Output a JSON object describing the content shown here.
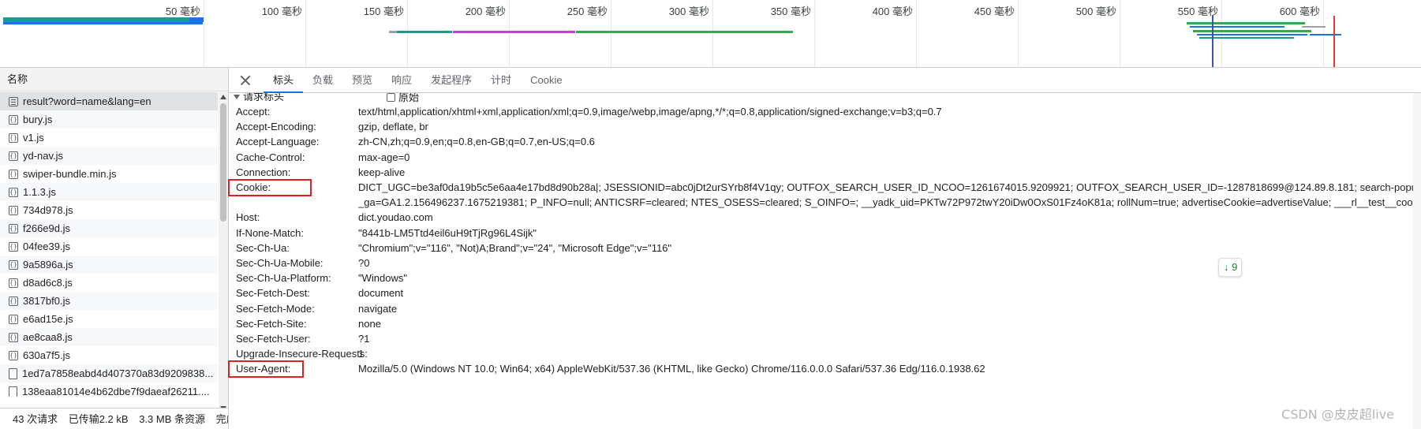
{
  "timeline": {
    "ticks": [
      {
        "label": "50 毫秒"
      },
      {
        "label": "100 毫秒"
      },
      {
        "label": "150 毫秒"
      },
      {
        "label": "200 毫秒"
      },
      {
        "label": "250 毫秒"
      },
      {
        "label": "300 毫秒"
      },
      {
        "label": "350 毫秒"
      },
      {
        "label": "400 毫秒"
      },
      {
        "label": "450 毫秒"
      },
      {
        "label": "500 毫秒"
      },
      {
        "label": "550 毫秒"
      },
      {
        "label": "600 毫秒"
      }
    ],
    "colors": {
      "teal": "#1e9c8a",
      "blue": "#1a73e8",
      "purple": "#c53fd6",
      "green": "#34a853",
      "grey": "#9aa0a6",
      "red_marker": "#e53935",
      "blue_marker": "#3f51b5"
    }
  },
  "request_list": {
    "header": "名称",
    "rows": [
      {
        "name": "result?word=name&lang=en",
        "icon": "document-icon",
        "selected": true
      },
      {
        "name": "bury.js",
        "icon": "script-icon"
      },
      {
        "name": "v1.js",
        "icon": "script-icon"
      },
      {
        "name": "yd-nav.js",
        "icon": "script-icon"
      },
      {
        "name": "swiper-bundle.min.js",
        "icon": "script-icon"
      },
      {
        "name": "1.1.3.js",
        "icon": "script-icon"
      },
      {
        "name": "734d978.js",
        "icon": "script-icon"
      },
      {
        "name": "f266e9d.js",
        "icon": "script-icon"
      },
      {
        "name": "04fee39.js",
        "icon": "script-icon"
      },
      {
        "name": "9a5896a.js",
        "icon": "script-icon"
      },
      {
        "name": "d8ad6c8.js",
        "icon": "script-icon"
      },
      {
        "name": "3817bf0.js",
        "icon": "script-icon"
      },
      {
        "name": "e6ad15e.js",
        "icon": "script-icon"
      },
      {
        "name": "ae8caa8.js",
        "icon": "script-icon"
      },
      {
        "name": "630a7f5.js",
        "icon": "script-icon"
      },
      {
        "name": "1ed7a7858eabd4d407370a83d9209838...",
        "icon": "file-icon"
      },
      {
        "name": "138eaa81014e4b62dbe7f9daeaf26211....",
        "icon": "file-icon"
      }
    ],
    "status": {
      "requests": "43 次请求",
      "transferred": "已传输2.2 kB",
      "resources": "3.3 MB 条资源",
      "finish": "完成:"
    }
  },
  "details": {
    "tabs": [
      {
        "label": "标头",
        "active": true
      },
      {
        "label": "负载"
      },
      {
        "label": "预览"
      },
      {
        "label": "响应"
      },
      {
        "label": "发起程序"
      },
      {
        "label": "计时"
      },
      {
        "label": "Cookie"
      }
    ],
    "section_title": "请求标头",
    "raw_label": "原始",
    "headers": [
      {
        "name": "Accept:",
        "value": "text/html,application/xhtml+xml,application/xml;q=0.9,image/webp,image/apng,*/*;q=0.8,application/signed-exchange;v=b3;q=0.7"
      },
      {
        "name": "Accept-Encoding:",
        "value": "gzip, deflate, br"
      },
      {
        "name": "Accept-Language:",
        "value": "zh-CN,zh;q=0.9,en;q=0.8,en-GB;q=0.7,en-US;q=0.6"
      },
      {
        "name": "Cache-Control:",
        "value": "max-age=0"
      },
      {
        "name": "Connection:",
        "value": "keep-alive"
      },
      {
        "name": "Cookie:",
        "value": "DICT_UGC=be3af0da19b5c5e6aa4e17bd8d90b28a|; JSESSIONID=abc0jDt2urSYrb8f4V1qy; OUTFOX_SEARCH_USER_ID_NCOO=1261674015.9209921; OUTFOX_SEARCH_USER_ID=-1287818699@124.89.8.181; search-popup-show",
        "value2": "_ga=GA1.2.156496237.1675219381; P_INFO=null; ANTICSRF=cleared; NTES_OSESS=cleared; S_OINFO=; __yadk_uid=PKTw72P972twY20iDw0OxS01Fz4oK81a; rollNum=true; advertiseCookie=advertiseValue; ___rl__test__cookies=",
        "highlight": true
      },
      {
        "name": "Host:",
        "value": "dict.youdao.com"
      },
      {
        "name": "If-None-Match:",
        "value": "\"8441b-LM5Ttd4eil6uH9tTjRg96L4Sijk\""
      },
      {
        "name": "Sec-Ch-Ua:",
        "value": "\"Chromium\";v=\"116\", \"Not)A;Brand\";v=\"24\", \"Microsoft Edge\";v=\"116\""
      },
      {
        "name": "Sec-Ch-Ua-Mobile:",
        "value": "?0"
      },
      {
        "name": "Sec-Ch-Ua-Platform:",
        "value": "\"Windows\""
      },
      {
        "name": "Sec-Fetch-Dest:",
        "value": "document"
      },
      {
        "name": "Sec-Fetch-Mode:",
        "value": "navigate"
      },
      {
        "name": "Sec-Fetch-Site:",
        "value": "none"
      },
      {
        "name": "Sec-Fetch-User:",
        "value": "?1"
      },
      {
        "name": "Upgrade-Insecure-Requests:",
        "value": "1"
      },
      {
        "name": "User-Agent:",
        "value": "Mozilla/5.0 (Windows NT 10.0; Win64; x64) AppleWebKit/537.36 (KHTML, like Gecko) Chrome/116.0.0.0 Safari/537.36 Edg/116.0.1938.62",
        "highlight": true
      }
    ],
    "scroll_button_label": "9"
  },
  "watermark": "CSDN @皮皮超live"
}
